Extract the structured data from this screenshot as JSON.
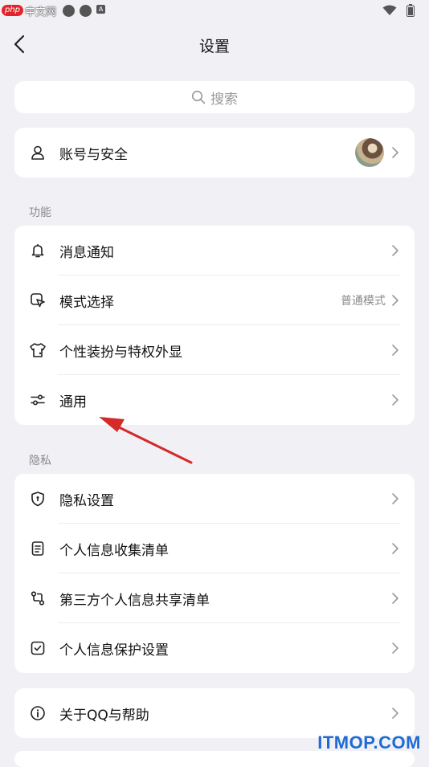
{
  "watermark_top": {
    "badge": "php",
    "text": "中文网"
  },
  "nav": {
    "title": "设置"
  },
  "search": {
    "placeholder": "搜索"
  },
  "account": {
    "label": "账号与安全"
  },
  "sections": {
    "features": "功能",
    "privacy": "隐私"
  },
  "features": [
    {
      "label": "消息通知",
      "icon": "bell-icon"
    },
    {
      "label": "模式选择",
      "icon": "mode-icon",
      "value": "普通模式"
    },
    {
      "label": "个性装扮与特权外显",
      "icon": "shirt-icon"
    },
    {
      "label": "通用",
      "icon": "sliders-icon"
    }
  ],
  "privacy": [
    {
      "label": "隐私设置",
      "icon": "shield-icon"
    },
    {
      "label": "个人信息收集清单",
      "icon": "document-icon"
    },
    {
      "label": "第三方个人信息共享清单",
      "icon": "share-icon"
    },
    {
      "label": "个人信息保护设置",
      "icon": "checkbox-icon"
    }
  ],
  "about": {
    "label": "关于QQ与帮助",
    "icon": "info-icon"
  },
  "watermark": "ITMOP.COM",
  "colors": {
    "background": "#f1f1f5",
    "annotation_arrow": "#d42a2a",
    "watermark": "#1f6bd3"
  }
}
